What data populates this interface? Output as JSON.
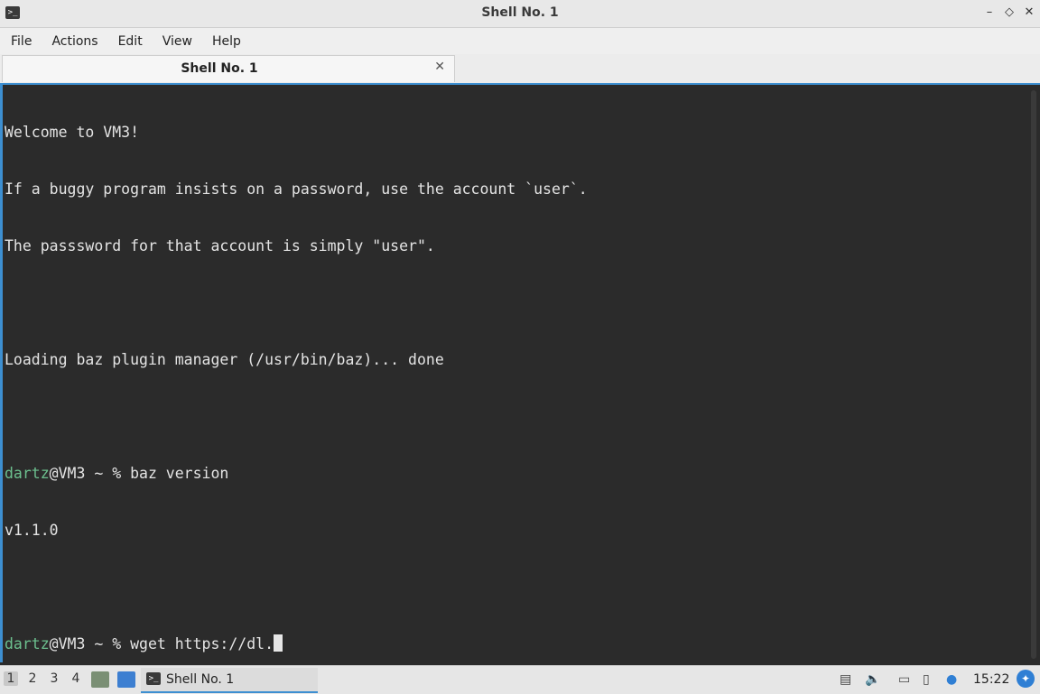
{
  "window": {
    "title": "Shell No. 1",
    "icon": "terminal-icon"
  },
  "window_controls": {
    "minimize": "–",
    "maximize": "◇",
    "close": "✕"
  },
  "menu": [
    "File",
    "Actions",
    "Edit",
    "View",
    "Help"
  ],
  "tab": {
    "label": "Shell No. 1",
    "close": "✕"
  },
  "terminal": {
    "lines": [
      "Welcome to VM3!",
      "If a buggy program insists on a password, use the account `user`.",
      "The passsword for that account is simply \"user\".",
      "",
      "Loading baz plugin manager (/usr/bin/baz)... done",
      "",
      {
        "user": "dartz",
        "rest": "@VM3 ~ % baz version"
      },
      "v1.1.0",
      "",
      {
        "user": "dartz",
        "rest": "@VM3 ~ % wget https://dl.",
        "cursor": true
      }
    ]
  },
  "taskbar": {
    "workspaces": [
      "1",
      "2",
      "3",
      "4"
    ],
    "active_workspace": "1",
    "task_label": "Shell No. 1",
    "clock": "15:22"
  },
  "colors": {
    "accent": "#3d8fd1",
    "username": "#6cbf8e",
    "terminal_bg": "#2b2b2b"
  }
}
